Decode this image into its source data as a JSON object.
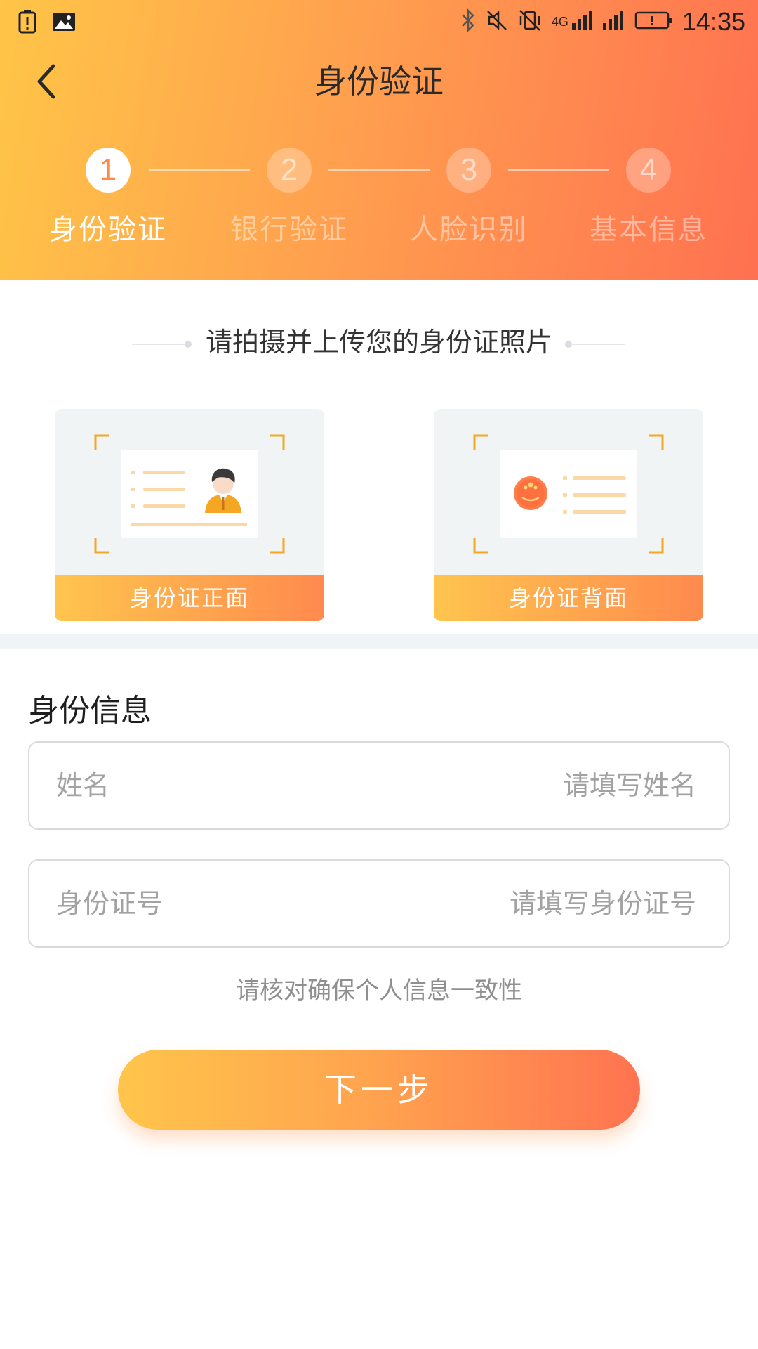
{
  "status_bar": {
    "time": "14:35",
    "network": "4G",
    "icons": [
      "battery-alert-icon",
      "image-icon",
      "bluetooth-icon",
      "mute-icon",
      "vibrate-off-icon",
      "signal-icon",
      "signal-icon",
      "battery-icon"
    ]
  },
  "header": {
    "title": "身份验证",
    "back_icon": "chevron-left-icon",
    "gradient": [
      "#ffc547",
      "#ffa04f",
      "#ff7150"
    ]
  },
  "steps": [
    {
      "number": "1",
      "label": "身份验证",
      "active": true
    },
    {
      "number": "2",
      "label": "银行验证",
      "active": false
    },
    {
      "number": "3",
      "label": "人脸识别",
      "active": false
    },
    {
      "number": "4",
      "label": "基本信息",
      "active": false
    }
  ],
  "upload": {
    "title": "请拍摄并上传您的身份证照片",
    "front_label": "身份证正面",
    "back_label": "身份证背面"
  },
  "identity": {
    "section_title": "身份信息",
    "name_label": "姓名",
    "name_placeholder": "请填写姓名",
    "name_value": "",
    "id_label": "身份证号",
    "id_placeholder": "请填写身份证号",
    "id_value": ""
  },
  "hint": "请核对确保个人信息一致性",
  "next_button": "下一步",
  "colors": {
    "accent_start": "#ffc54b",
    "accent_end": "#ff7350",
    "card_bg": "#f1f4f5",
    "corner_orange": "#f5a623"
  }
}
